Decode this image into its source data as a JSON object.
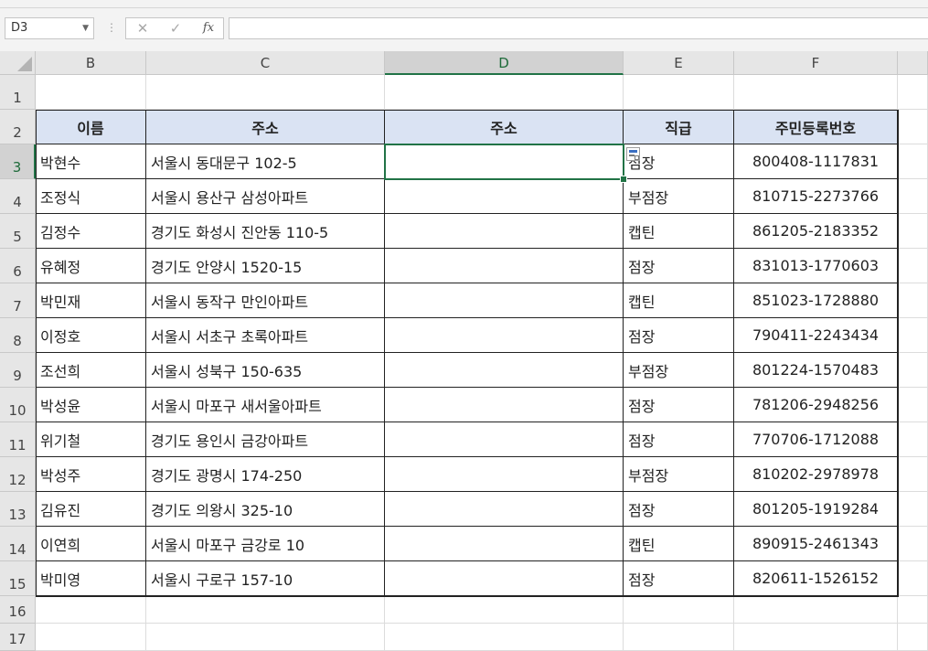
{
  "formula_bar": {
    "name_box": "D3",
    "cancel_glyph": "✕",
    "enter_glyph": "✓",
    "fx_label": "fx",
    "formula": ""
  },
  "columns": [
    "B",
    "C",
    "D",
    "E",
    "F"
  ],
  "rows": [
    "1",
    "2",
    "3",
    "4",
    "5",
    "6",
    "7",
    "8",
    "9",
    "10",
    "11",
    "12",
    "13",
    "14",
    "15",
    "16",
    "17"
  ],
  "table": {
    "headers": [
      "이름",
      "주소",
      "주소",
      "직급",
      "주민등록번호"
    ],
    "data": [
      [
        "박현수",
        "서울시 동대문구 102-5",
        "",
        "점장",
        "800408-1117831"
      ],
      [
        "조정식",
        "서울시 용산구 삼성아파트",
        "",
        "부점장",
        "810715-2273766"
      ],
      [
        "김정수",
        "경기도 화성시 진안동 110-5",
        "",
        "캡틴",
        "861205-2183352"
      ],
      [
        "유혜정",
        "경기도 안양시 1520-15",
        "",
        "점장",
        "831013-1770603"
      ],
      [
        "박민재",
        "서울시 동작구 만인아파트",
        "",
        "캡틴",
        "851023-1728880"
      ],
      [
        "이정호",
        "서울시 서초구 초록아파트",
        "",
        "점장",
        "790411-2243434"
      ],
      [
        "조선희",
        "서울시 성북구 150-635",
        "",
        "부점장",
        "801224-1570483"
      ],
      [
        "박성윤",
        "서울시 마포구 새서울아파트",
        "",
        "점장",
        "781206-2948256"
      ],
      [
        "위기철",
        "경기도 용인시 금강아파트",
        "",
        "점장",
        "770706-1712088"
      ],
      [
        "박성주",
        "경기도 광명시 174-250",
        "",
        "부점장",
        "810202-2978978"
      ],
      [
        "김유진",
        "경기도 의왕시 325-10",
        "",
        "점장",
        "801205-1919284"
      ],
      [
        "이연희",
        "서울시 마포구 금강로 10",
        "",
        "캡틴",
        "890915-2461343"
      ],
      [
        "박미영",
        "서울시 구로구 157-10",
        "",
        "점장",
        "820611-1526152"
      ]
    ]
  },
  "selected_cell": "D3",
  "colors": {
    "header_fill": "#dae3f3",
    "selection": "#217346"
  },
  "icons": {
    "paste_options": "paste-options-icon",
    "fx": "function-icon"
  }
}
